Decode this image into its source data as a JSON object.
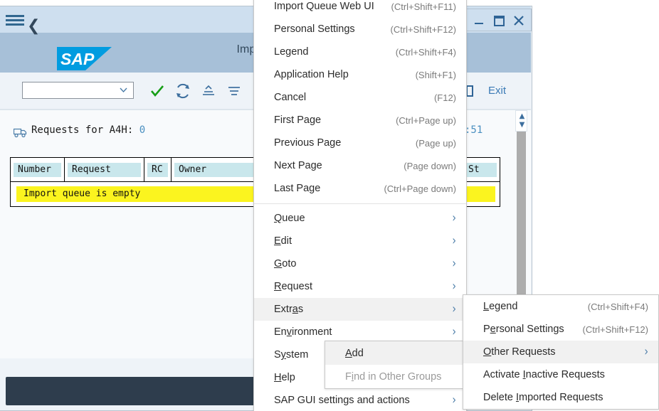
{
  "window": {
    "caption_buttons": [
      {
        "name": "minimize",
        "glyph": "minimize-icon"
      },
      {
        "name": "maximize",
        "glyph": "maximize-icon"
      },
      {
        "name": "close",
        "glyph": "close-icon"
      }
    ]
  },
  "shell": {
    "menu_icon": "hamburger-menu-icon",
    "back_icon": "back-chevron-icon",
    "logo": "SAP",
    "title": "Import Que"
  },
  "toolbar": {
    "select_value": "",
    "select_placeholder": "",
    "icons": [
      {
        "name": "check-icon",
        "title": "Continue"
      },
      {
        "name": "refresh-icon",
        "title": "Refresh"
      },
      {
        "name": "collapse-icon",
        "title": "Collapse"
      },
      {
        "name": "sort-icon",
        "title": "Sort"
      }
    ],
    "exit_label": "Exit",
    "exit_icon": "exit-icon"
  },
  "content": {
    "truck_icon": "truck-icon",
    "requests_label": "Requests for A4H:",
    "requests_count": "0",
    "right_clipped_text": ":51",
    "table": {
      "columns": [
        "Number",
        "Request",
        "RC",
        "Owner",
        "St"
      ],
      "empty_message": "Import queue is empty"
    },
    "scroll_up_icon": "chevron-up-icon",
    "scroll_down_icon": "chevron-down-icon"
  },
  "menus": {
    "main": {
      "items": [
        {
          "label": "Import Queue Web UI",
          "accel": "(Ctrl+Shift+F11)",
          "type": "item"
        },
        {
          "label": "Personal Settings",
          "accel": "(Ctrl+Shift+F12)",
          "type": "item"
        },
        {
          "label": "Legend",
          "accel": "(Ctrl+Shift+F4)",
          "type": "item"
        },
        {
          "label": "Application Help",
          "accel": "(Shift+F1)",
          "type": "item"
        },
        {
          "label": "Cancel",
          "accel": "(F12)",
          "type": "item"
        },
        {
          "label": "First Page",
          "accel": "(Ctrl+Page up)",
          "type": "item"
        },
        {
          "label": "Previous Page",
          "accel": "(Page up)",
          "type": "item"
        },
        {
          "label": "Next Page",
          "accel": "(Page down)",
          "type": "item"
        },
        {
          "label": "Last Page",
          "accel": "(Ctrl+Page down)",
          "type": "item"
        },
        {
          "type": "separator"
        },
        {
          "label": "Queue",
          "mnemonic": "Q",
          "type": "submenu"
        },
        {
          "label": "Edit",
          "mnemonic": "E",
          "type": "submenu"
        },
        {
          "label": "Goto",
          "mnemonic": "G",
          "type": "submenu"
        },
        {
          "label": "Request",
          "mnemonic": "R",
          "type": "submenu"
        },
        {
          "label": "Extras",
          "mnemonic": "a",
          "type": "submenu",
          "selected": true
        },
        {
          "label": "Environment",
          "mnemonic": "v",
          "type": "submenu"
        },
        {
          "label": "System",
          "mnemonic": "y",
          "type": "item"
        },
        {
          "label": "Help",
          "mnemonic": "H",
          "type": "item"
        },
        {
          "label": "SAP GUI settings and actions",
          "type": "submenu"
        }
      ]
    },
    "extras": {
      "items": [
        {
          "label": "Legend",
          "mnemonic": "L",
          "accel": "(Ctrl+Shift+F4)",
          "type": "item"
        },
        {
          "label": "Personal Settings",
          "mnemonic": "e",
          "accel": "(Ctrl+Shift+F12)",
          "type": "item"
        },
        {
          "label": "Other Requests",
          "mnemonic": "O",
          "type": "submenu",
          "selected": true
        },
        {
          "label": "Activate Inactive Requests",
          "mnemonic": "I",
          "type": "item"
        },
        {
          "label": "Delete Imported Requests",
          "mnemonic": "I",
          "type": "item"
        }
      ]
    },
    "add": {
      "items": [
        {
          "label": "Add",
          "mnemonic": "A",
          "type": "item",
          "selected": true
        },
        {
          "label": "Find in Other Groups",
          "mnemonic": "i",
          "type": "item",
          "disabled": true
        }
      ]
    }
  },
  "colors": {
    "shell_bar": "#cedfef",
    "header_band": "#a7c0d8",
    "toolbar_bg": "#eef3f8",
    "sap_blue": "#019ce0",
    "highlight_yellow": "#fbf41f",
    "column_header": "#c9e7ec",
    "status_bar": "#2e3d4d",
    "accent_link": "#3b7ab5"
  }
}
